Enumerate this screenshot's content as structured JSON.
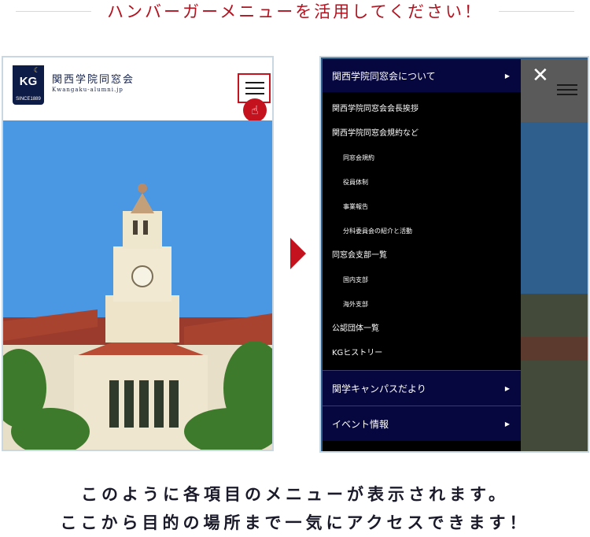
{
  "top_heading": "ハンバーガーメニューを活用してください！",
  "site": {
    "badge_kg": "KG",
    "badge_since": "SINCE1889",
    "name": "関西学院同窓会",
    "url": "Kwangaku-alumni.jp"
  },
  "menu": {
    "header_item": "関西学院同窓会について",
    "items": [
      {
        "label": "関西学院同窓会会長挨拶",
        "level": 1
      },
      {
        "label": "関西学院同窓会規約など",
        "level": 1
      },
      {
        "label": "同窓会規約",
        "level": 2
      },
      {
        "label": "役員体制",
        "level": 2
      },
      {
        "label": "事業報告",
        "level": 2
      },
      {
        "label": "分科委員会の紹介と活動",
        "level": 2
      },
      {
        "label": "同窓会支部一覧",
        "level": 1
      },
      {
        "label": "国内支部",
        "level": 2
      },
      {
        "label": "海外支部",
        "level": 2
      },
      {
        "label": "公認団体一覧",
        "level": 1
      },
      {
        "label": "KGヒストリー",
        "level": 1
      }
    ],
    "footer_items": [
      "関学キャンパスだより",
      "イベント情報"
    ]
  },
  "caption": {
    "line1": "このように各項目のメニューが表示されます。",
    "line2": "ここから目的の場所まで一気にアクセスできます！"
  },
  "colors": {
    "accent_red": "#c4121f",
    "navy": "#07073f"
  },
  "icons": [
    "hamburger-menu-icon",
    "pointer-hand-icon",
    "close-icon",
    "chevron-right-icon",
    "arrow-right-icon",
    "moon-icon"
  ]
}
